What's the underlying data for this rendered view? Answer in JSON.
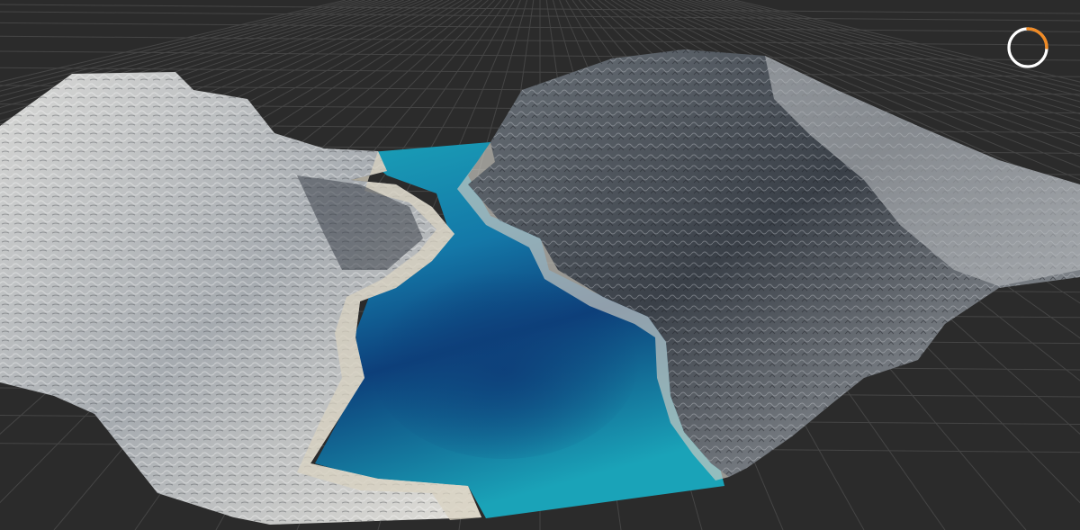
{
  "viewport": {
    "background_color": "#2b2b2b",
    "grid_line_color": "#454545"
  },
  "terrain": {
    "water_shallow_color": "#1aa3b8",
    "water_mid_color": "#1478a8",
    "water_deep_color": "#0d3f7a",
    "rock_light_color": "#e8e8e6",
    "rock_mid_color": "#8e9499",
    "rock_dark_color": "#3a4048",
    "shore_color": "#d8d2c0"
  },
  "loading_indicator": {
    "icon": "progress-ring-icon",
    "progress": 0.25,
    "track_color": "#ffffff",
    "accent_color": "#f08a24"
  }
}
